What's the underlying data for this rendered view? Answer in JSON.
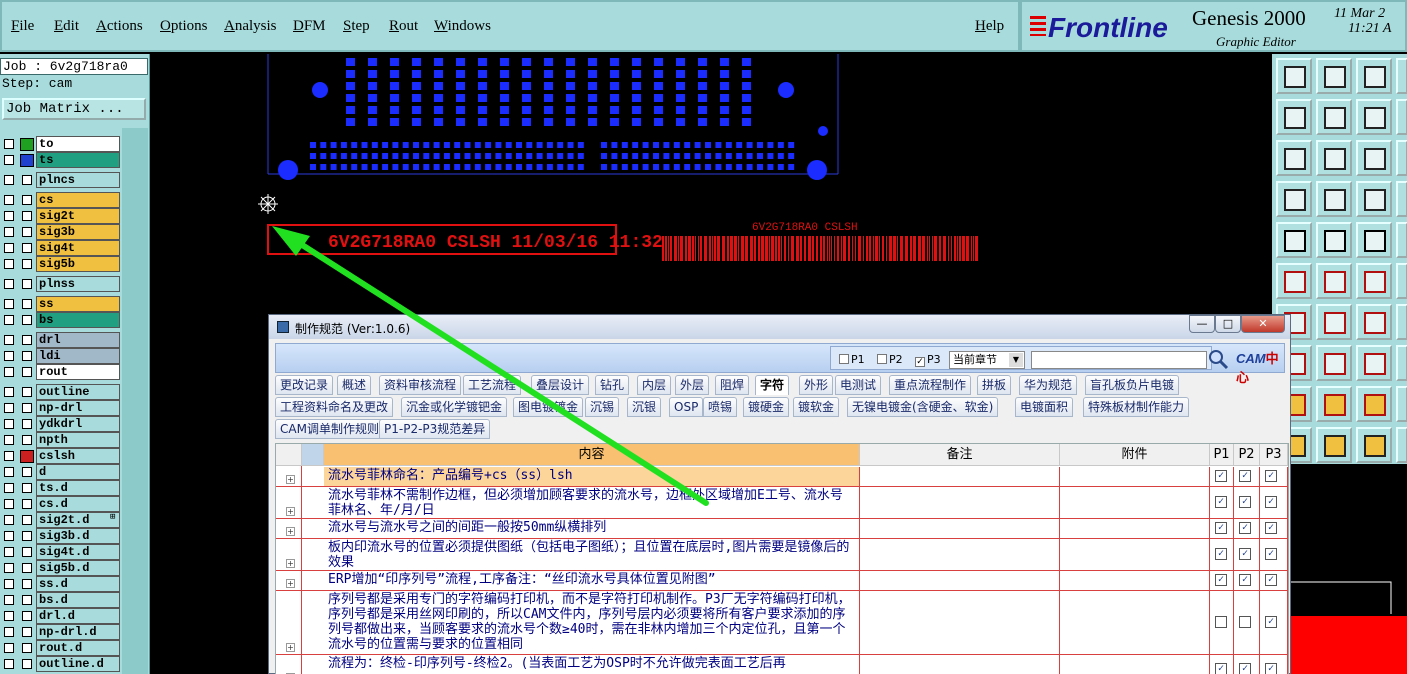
{
  "menu": {
    "items": [
      "File",
      "Edit",
      "Actions",
      "Options",
      "Analysis",
      "DFM",
      "Step",
      "Rout",
      "Windows"
    ],
    "help": "Help"
  },
  "brand": {
    "logo": "Frontline",
    "app_name": "Genesis 2000",
    "subtitle": "Graphic Editor",
    "date": "11 Mar 2",
    "time": "11:21 A"
  },
  "left_panel": {
    "job": "Job : 6v2g718ra0",
    "step": "Step: cam",
    "job_matrix_label": "Job Matrix ...",
    "layers": [
      {
        "name": "to",
        "color": "#ffffff",
        "swatch": "#20a020"
      },
      {
        "name": "ts",
        "color": "#20a080",
        "swatch": "#2040d0"
      },
      {
        "name": "plncs",
        "color": "#a8dcdc",
        "swatch": ""
      },
      {
        "name": "cs",
        "color": "#f0c040",
        "swatch": ""
      },
      {
        "name": "sig2t",
        "color": "#f0c040",
        "swatch": ""
      },
      {
        "name": "sig3b",
        "color": "#f0c040",
        "swatch": ""
      },
      {
        "name": "sig4t",
        "color": "#f0c040",
        "swatch": ""
      },
      {
        "name": "sig5b",
        "color": "#f0c040",
        "swatch": ""
      },
      {
        "name": "plnss",
        "color": "#a8dcdc",
        "swatch": ""
      },
      {
        "name": "ss",
        "color": "#f0c040",
        "swatch": ""
      },
      {
        "name": "bs",
        "color": "#20a080",
        "swatch": ""
      },
      {
        "name": "drl",
        "color": "#a0b8c8",
        "swatch": ""
      },
      {
        "name": "ldi",
        "color": "#a0b8c8",
        "swatch": ""
      },
      {
        "name": "rout",
        "color": "#ffffff",
        "swatch": ""
      },
      {
        "name": "outline",
        "color": "#a8dcdc",
        "swatch": ""
      },
      {
        "name": "np-drl",
        "color": "#a8dcdc",
        "swatch": ""
      },
      {
        "name": "ydkdrl",
        "color": "#a8dcdc",
        "swatch": ""
      },
      {
        "name": "npth",
        "color": "#a8dcdc",
        "swatch": ""
      },
      {
        "name": "cslsh",
        "color": "#a8dcdc",
        "swatch": "#cc2020"
      },
      {
        "name": "d",
        "color": "#a8dcdc",
        "swatch": ""
      },
      {
        "name": "ts.d",
        "color": "#a8dcdc",
        "swatch": ""
      },
      {
        "name": "cs.d",
        "color": "#a8dcdc",
        "swatch": ""
      },
      {
        "name": "sig2t.d",
        "color": "#a8dcdc",
        "swatch": ""
      },
      {
        "name": "sig3b.d",
        "color": "#a8dcdc",
        "swatch": ""
      },
      {
        "name": "sig4t.d",
        "color": "#a8dcdc",
        "swatch": ""
      },
      {
        "name": "sig5b.d",
        "color": "#a8dcdc",
        "swatch": ""
      },
      {
        "name": "ss.d",
        "color": "#a8dcdc",
        "swatch": ""
      },
      {
        "name": "bs.d",
        "color": "#a8dcdc",
        "swatch": ""
      },
      {
        "name": "drl.d",
        "color": "#a8dcdc",
        "swatch": ""
      },
      {
        "name": "np-drl.d",
        "color": "#a8dcdc",
        "swatch": ""
      },
      {
        "name": "rout.d",
        "color": "#a8dcdc",
        "swatch": ""
      },
      {
        "name": "outline.d",
        "color": "#a8dcdc",
        "swatch": ""
      }
    ],
    "plus_glyph": "⊞"
  },
  "canvas": {
    "serial_text": "6V2G718RA0 CSLSH 11/03/16 11:32",
    "barcode_text": "6V2G718RA0 CSLSH"
  },
  "dialog": {
    "title": "制作规范 (Ver:1.0.6)",
    "window_buttons": [
      "—",
      "□",
      "✕"
    ],
    "filters": [
      {
        "label": "P1",
        "checked": false
      },
      {
        "label": "P2",
        "checked": false
      },
      {
        "label": "P3",
        "checked": true
      }
    ],
    "chapter_select": "当前章节",
    "search_value": "",
    "logo_text": "CAM",
    "logo_suffix": "中心",
    "tabs_row1": [
      "更改记录",
      "概述",
      "资料审核流程",
      "工艺流程",
      "叠层设计",
      "钻孔",
      "内层",
      "外层",
      "阻焊",
      "字符",
      "外形",
      "电测试",
      "重点流程制作",
      "拼板",
      "华为规范",
      "盲孔板负片电镀"
    ],
    "tabs_row2": [
      "工程资料命名及更改",
      "沉金或化学镀钯金",
      "图电镀镀金",
      "沉锡",
      "沉银",
      "OSP",
      "喷锡",
      "镀硬金",
      "镀软金",
      "无镍电镀金(含硬金、软金)",
      "电镀面积",
      "特殊板材制作能力"
    ],
    "tabs_row3": [
      "CAM调单制作规则",
      "P1-P2-P3规范差异"
    ],
    "active_tab": "字符",
    "columns": [
      "内容",
      "备注",
      "附件",
      "P1",
      "P2",
      "P3"
    ],
    "rows": [
      {
        "content": "流水号菲林命名：产品编号+cs（ss）lsh",
        "p1": true,
        "p2": true,
        "p3": true,
        "highlight": true
      },
      {
        "content": "流水号菲林不需制作边框，但必须增加顾客要求的流水号，边框外区域增加E工号、流水号菲林名、年/月/日",
        "p1": true,
        "p2": true,
        "p3": true,
        "highlight": false
      },
      {
        "content": "流水号与流水号之间的间距一般按50mm纵横排列",
        "p1": true,
        "p2": true,
        "p3": true,
        "highlight": false
      },
      {
        "content": "板内印流水号的位置必须提供图纸（包括电子图纸）；且位置在底层时,图片需要是镜像后的效果",
        "p1": true,
        "p2": true,
        "p3": true,
        "highlight": false
      },
      {
        "content": "ERP增加“印序列号”流程,工序备注：“丝印流水号具体位置见附图”",
        "p1": true,
        "p2": true,
        "p3": true,
        "highlight": false
      },
      {
        "content": "序列号都是采用专门的字符编码打印机，而不是字符打印机制作。P3厂无字符编码打印机，序列号都是采用丝网印刷的，所以CAM文件内，序列号层内必须要将所有客户要求添加的序列号都做出来，当顾客要求的流水号个数≥40时，需在非林内增加三个内定位孔，且第一个流水号的位置需与要求的位置相同",
        "p1": false,
        "p2": false,
        "p3": true,
        "highlight": false
      },
      {
        "content": "流程为：终检-印序列号-终检2。(当表面工艺为OSP时不允许做完表面工艺后再",
        "p1": true,
        "p2": true,
        "p3": true,
        "highlight": false
      }
    ]
  },
  "colors": {
    "panel": "#a8dcdc",
    "pcb_pad": "#1a2cff",
    "silk_red": "#e01010",
    "arrow": "#20e020"
  }
}
